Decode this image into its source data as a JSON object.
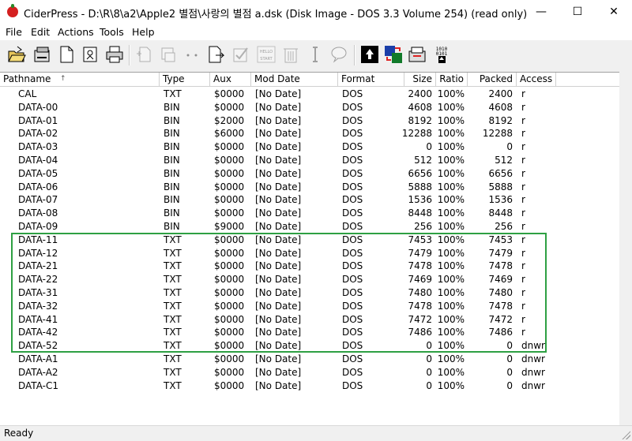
{
  "window": {
    "title": "CiderPress - D:\\R\\8\\a2\\Apple2 별점\\사랑의 별점 a.dsk (Disk Image - DOS 3.3 Volume 254) (read only)",
    "minimize_glyph": "—",
    "maximize_glyph": "☐",
    "close_glyph": "✕"
  },
  "menu": [
    "File",
    "Edit",
    "Actions",
    "Tools",
    "Help"
  ],
  "columns": [
    "Pathname",
    "Type",
    "Aux",
    "Mod Date",
    "Format",
    "Size",
    "Ratio",
    "Packed",
    "Access"
  ],
  "sort_indicator": "↑",
  "rows": [
    [
      "CAL",
      "TXT",
      "$0000",
      "[No Date]",
      "DOS",
      "2400",
      "100%",
      "2400",
      "r"
    ],
    [
      "DATA-00",
      "BIN",
      "$0000",
      "[No Date]",
      "DOS",
      "4608",
      "100%",
      "4608",
      "r"
    ],
    [
      "DATA-01",
      "BIN",
      "$2000",
      "[No Date]",
      "DOS",
      "8192",
      "100%",
      "8192",
      "r"
    ],
    [
      "DATA-02",
      "BIN",
      "$6000",
      "[No Date]",
      "DOS",
      "12288",
      "100%",
      "12288",
      "r"
    ],
    [
      "DATA-03",
      "BIN",
      "$0000",
      "[No Date]",
      "DOS",
      "0",
      "100%",
      "0",
      "r"
    ],
    [
      "DATA-04",
      "BIN",
      "$0000",
      "[No Date]",
      "DOS",
      "512",
      "100%",
      "512",
      "r"
    ],
    [
      "DATA-05",
      "BIN",
      "$0000",
      "[No Date]",
      "DOS",
      "6656",
      "100%",
      "6656",
      "r"
    ],
    [
      "DATA-06",
      "BIN",
      "$0000",
      "[No Date]",
      "DOS",
      "5888",
      "100%",
      "5888",
      "r"
    ],
    [
      "DATA-07",
      "BIN",
      "$0000",
      "[No Date]",
      "DOS",
      "1536",
      "100%",
      "1536",
      "r"
    ],
    [
      "DATA-08",
      "BIN",
      "$0000",
      "[No Date]",
      "DOS",
      "8448",
      "100%",
      "8448",
      "r"
    ],
    [
      "DATA-09",
      "BIN",
      "$9000",
      "[No Date]",
      "DOS",
      "256",
      "100%",
      "256",
      "r"
    ],
    [
      "DATA-11",
      "TXT",
      "$0000",
      "[No Date]",
      "DOS",
      "7453",
      "100%",
      "7453",
      "r"
    ],
    [
      "DATA-12",
      "TXT",
      "$0000",
      "[No Date]",
      "DOS",
      "7479",
      "100%",
      "7479",
      "r"
    ],
    [
      "DATA-21",
      "TXT",
      "$0000",
      "[No Date]",
      "DOS",
      "7478",
      "100%",
      "7478",
      "r"
    ],
    [
      "DATA-22",
      "TXT",
      "$0000",
      "[No Date]",
      "DOS",
      "7469",
      "100%",
      "7469",
      "r"
    ],
    [
      "DATA-31",
      "TXT",
      "$0000",
      "[No Date]",
      "DOS",
      "7480",
      "100%",
      "7480",
      "r"
    ],
    [
      "DATA-32",
      "TXT",
      "$0000",
      "[No Date]",
      "DOS",
      "7478",
      "100%",
      "7478",
      "r"
    ],
    [
      "DATA-41",
      "TXT",
      "$0000",
      "[No Date]",
      "DOS",
      "7472",
      "100%",
      "7472",
      "r"
    ],
    [
      "DATA-42",
      "TXT",
      "$0000",
      "[No Date]",
      "DOS",
      "7486",
      "100%",
      "7486",
      "r"
    ],
    [
      "DATA-52",
      "TXT",
      "$0000",
      "[No Date]",
      "DOS",
      "0",
      "100%",
      "0",
      "dnwr"
    ],
    [
      "DATA-A1",
      "TXT",
      "$0000",
      "[No Date]",
      "DOS",
      "0",
      "100%",
      "0",
      "dnwr"
    ],
    [
      "DATA-A2",
      "TXT",
      "$0000",
      "[No Date]",
      "DOS",
      "0",
      "100%",
      "0",
      "dnwr"
    ],
    [
      "DATA-C1",
      "TXT",
      "$0000",
      "[No Date]",
      "DOS",
      "0",
      "100%",
      "0",
      "dnwr"
    ]
  ],
  "toolbar_icons": [
    "open-archive-icon",
    "open-volume-icon",
    "new-archive-icon",
    "archive-info-icon",
    "print-icon",
    "add-files-icon",
    "add-disk-icon",
    "create-subdirectory-icon",
    "extract-icon",
    "test-icon",
    "run-icon",
    "delete-icon",
    "rename-icon",
    "comment-icon",
    "disk-image-converter-icon",
    "volume-copier-icon",
    "merge-icon",
    "binary-viewer-icon"
  ],
  "highlight_color": "#2ea043",
  "status": "Ready"
}
